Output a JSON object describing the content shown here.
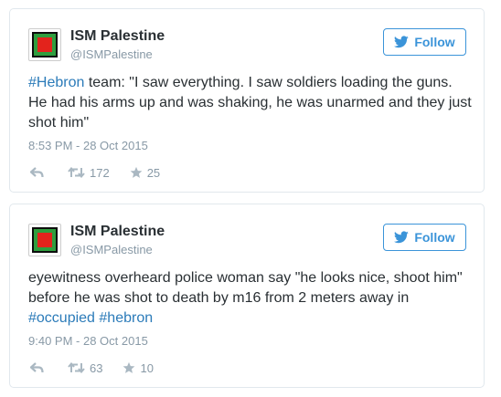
{
  "tweets": [
    {
      "display_name": "ISM Palestine",
      "screen_name": "@ISMPalestine",
      "follow_label": "Follow",
      "text_hashtag_1": "#Hebron",
      "text_main": " team: \"I saw everything. I saw soldiers loading the guns. He had his arms up and was shaking, he was unarmed and they just shot him\"",
      "timestamp": "8:53 PM - 28 Oct 2015",
      "retweets": "172",
      "likes": "25"
    },
    {
      "display_name": "ISM Palestine",
      "screen_name": "@ISMPalestine",
      "follow_label": "Follow",
      "text_main": "eyewitness overheard police woman say \"he looks nice, shoot him\" before he was shot to death by m16 from 2 meters away in ",
      "text_hashtag_1": "#occupied",
      "text_space": " ",
      "text_hashtag_2": "#hebron",
      "timestamp": "9:40 PM - 28 Oct 2015",
      "retweets": "63",
      "likes": "10"
    }
  ],
  "icons": {
    "follow": "twitter-bird-icon",
    "reply": "reply-arrow-icon",
    "retweet": "retweet-icon",
    "like": "star-icon"
  },
  "colors": {
    "link": "#2b7bb9",
    "follow": "#3b94d9",
    "muted": "#8899a6",
    "icon": "#aab8c2",
    "border": "#e1e8ed",
    "avatar_red": "#e3231c",
    "avatar_green": "#2f9e3e"
  }
}
